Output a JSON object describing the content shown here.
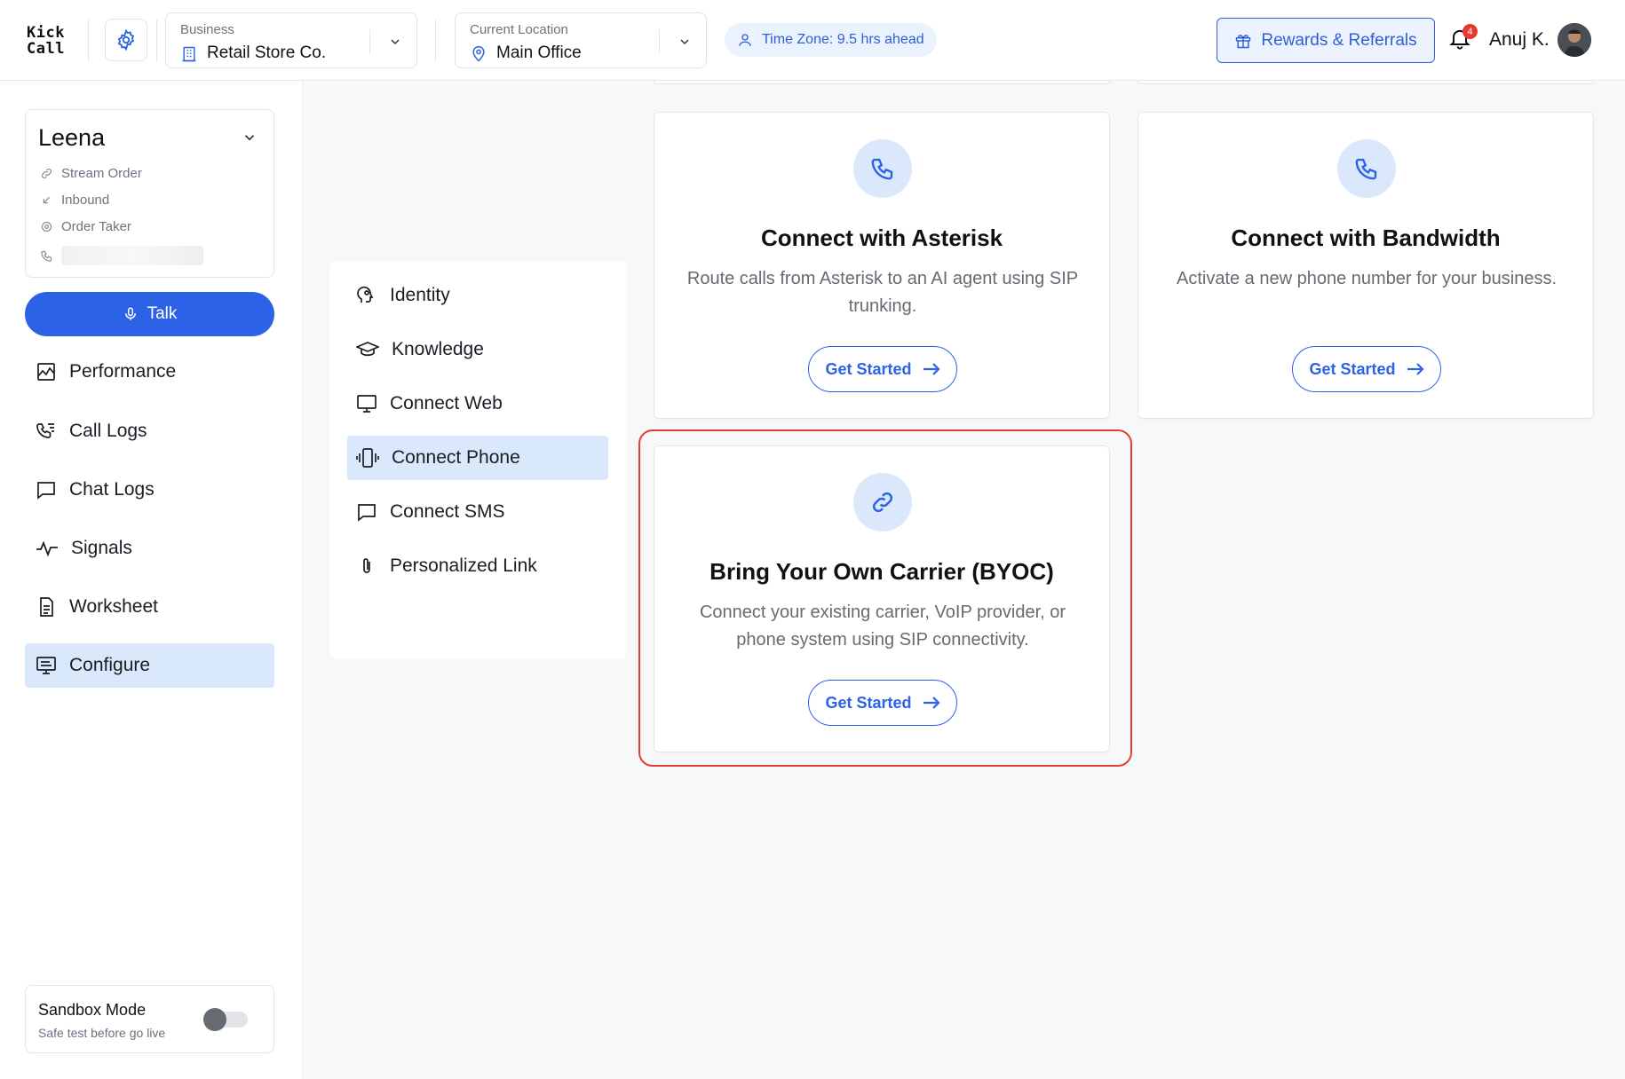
{
  "header": {
    "logo_line1": "Kick",
    "logo_line2": "Call",
    "business": {
      "label": "Business",
      "value": "Retail Store Co."
    },
    "location": {
      "label": "Current Location",
      "value": "Main Office"
    },
    "timezone": "Time Zone: 9.5 hrs ahead",
    "rewards_label": "Rewards & Referrals",
    "notification_count": "4",
    "user_name": "Anuj K."
  },
  "sidebar": {
    "agent": {
      "name": "Leena",
      "meta": [
        {
          "icon": "link-icon",
          "text": "Stream Order"
        },
        {
          "icon": "arrow-down-left-icon",
          "text": "Inbound"
        },
        {
          "icon": "gear-icon",
          "text": "Order Taker"
        }
      ]
    },
    "talk_label": "Talk",
    "items": [
      {
        "label": "Performance",
        "icon": "chart-icon"
      },
      {
        "label": "Call Logs",
        "icon": "call-log-icon"
      },
      {
        "label": "Chat Logs",
        "icon": "chat-icon"
      },
      {
        "label": "Signals",
        "icon": "pulse-icon"
      },
      {
        "label": "Worksheet",
        "icon": "document-icon"
      },
      {
        "label": "Configure",
        "icon": "monitor-settings-icon",
        "active": true
      }
    ],
    "sandbox": {
      "title": "Sandbox Mode",
      "subtitle": "Safe test before go live",
      "enabled": false
    }
  },
  "submenu": {
    "items": [
      {
        "label": "Identity",
        "icon": "head-icon"
      },
      {
        "label": "Knowledge",
        "icon": "graduation-cap-icon"
      },
      {
        "label": "Connect Web",
        "icon": "monitor-icon"
      },
      {
        "label": "Connect Phone",
        "icon": "phone-vibrate-icon",
        "active": true
      },
      {
        "label": "Connect SMS",
        "icon": "message-icon"
      },
      {
        "label": "Personalized Link",
        "icon": "paperclip-icon"
      }
    ]
  },
  "cards": [
    {
      "title": "Connect with Asterisk",
      "description": "Route calls from Asterisk to an AI agent using SIP trunking.",
      "button": "Get Started",
      "icon": "phone-icon"
    },
    {
      "title": "Connect with Bandwidth",
      "description": "Activate a new phone number for your business.",
      "button": "Get Started",
      "icon": "phone-icon"
    },
    {
      "title": "Bring Your Own Carrier (BYOC)",
      "description": "Connect your existing carrier, VoIP provider, or phone system using SIP connectivity.",
      "button": "Get Started",
      "icon": "link-icon",
      "highlighted": true
    }
  ],
  "colors": {
    "accent": "#2b62e6",
    "active_bg": "#d9e9fb",
    "highlight": "#e0402d"
  }
}
